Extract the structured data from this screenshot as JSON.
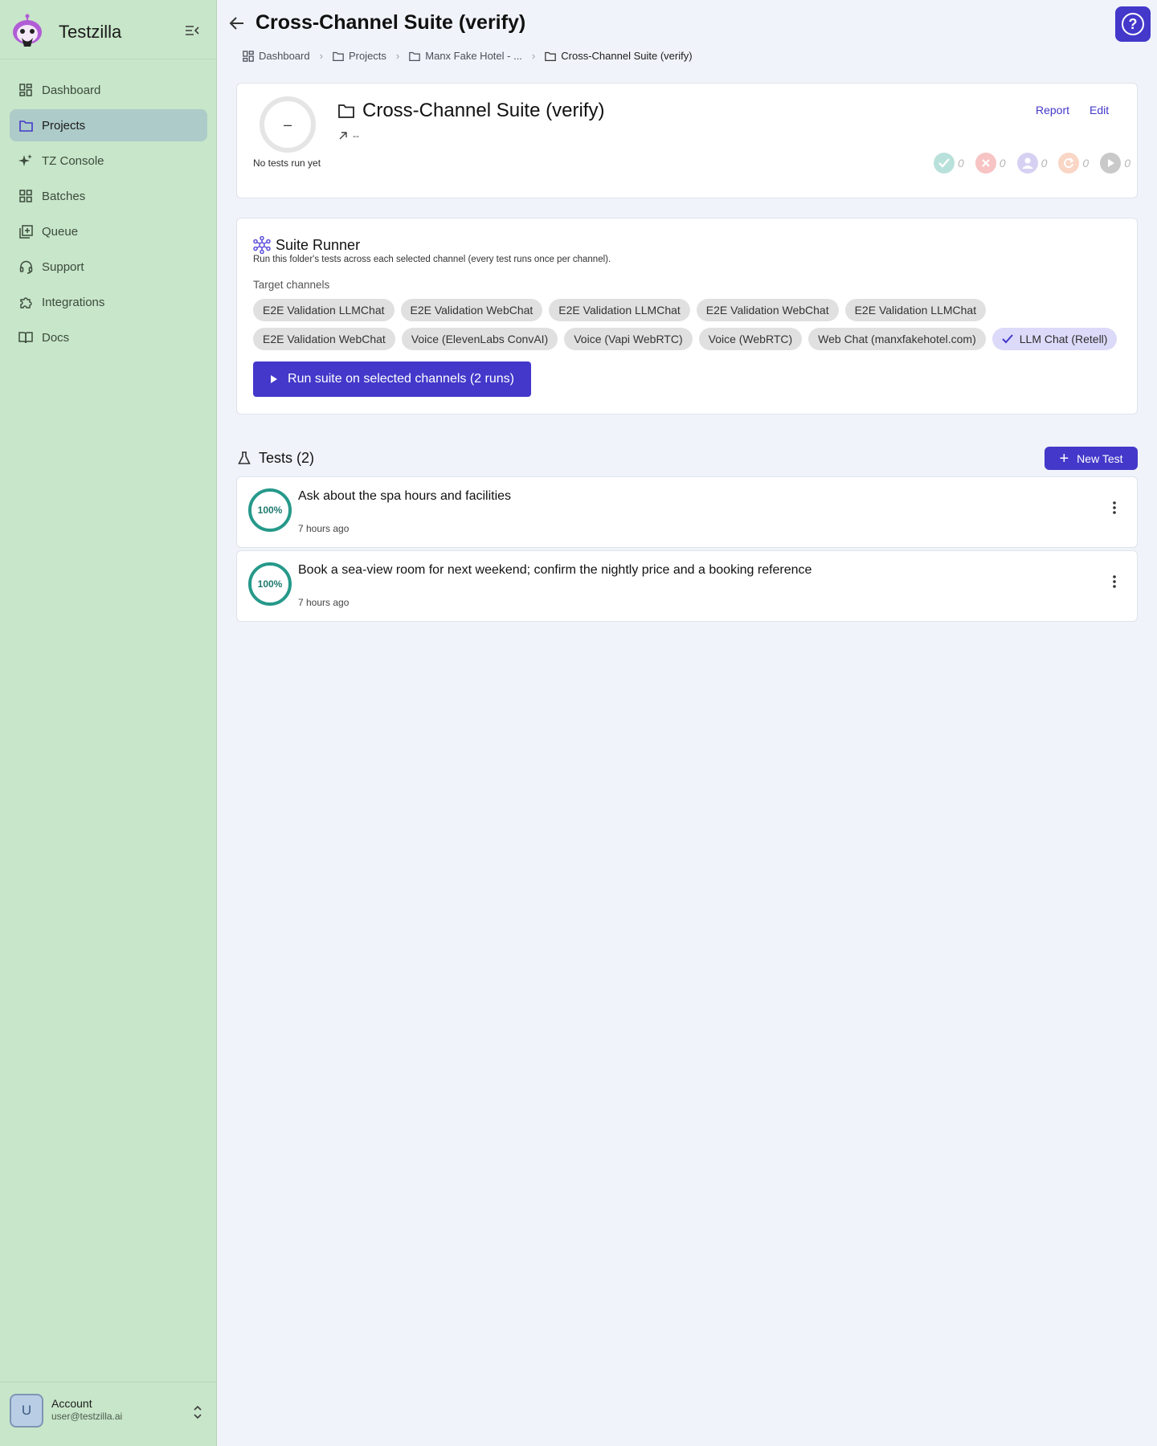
{
  "app": {
    "name": "Testzilla"
  },
  "sidebar": {
    "items": [
      {
        "label": "Dashboard",
        "icon": "dashboard-icon",
        "active": false
      },
      {
        "label": "Projects",
        "icon": "folder-icon",
        "active": true
      },
      {
        "label": "TZ Console",
        "icon": "sparkle-icon",
        "active": false
      },
      {
        "label": "Batches",
        "icon": "grid-icon",
        "active": false
      },
      {
        "label": "Queue",
        "icon": "queue-icon",
        "active": false
      },
      {
        "label": "Support",
        "icon": "headset-icon",
        "active": false
      },
      {
        "label": "Integrations",
        "icon": "puzzle-icon",
        "active": false
      },
      {
        "label": "Docs",
        "icon": "book-icon",
        "active": false
      }
    ]
  },
  "account": {
    "initial": "U",
    "name": "Account",
    "email": "user@testzilla.ai"
  },
  "header": {
    "title": "Cross-Channel Suite (verify)",
    "breadcrumb": [
      "Dashboard",
      "Projects",
      "Manx Fake Hotel - ...",
      "Cross-Channel Suite (verify)"
    ]
  },
  "summary": {
    "score": "–",
    "caption": "No tests run yet",
    "title": "Cross-Channel Suite (verify)",
    "trend": "--",
    "report_label": "Report",
    "edit_label": "Edit",
    "stats": {
      "passed": "0",
      "failed": "0",
      "review": "0",
      "retry": "0",
      "pending": "0"
    }
  },
  "runner": {
    "title": "Suite Runner",
    "description": "Run this folder's tests across each selected channel (every test runs once per channel).",
    "channels_label": "Target channels",
    "channels": [
      {
        "label": "E2E Validation LLMChat",
        "selected": false
      },
      {
        "label": "E2E Validation WebChat",
        "selected": false
      },
      {
        "label": "E2E Validation LLMChat",
        "selected": false
      },
      {
        "label": "E2E Validation WebChat",
        "selected": false
      },
      {
        "label": "E2E Validation LLMChat",
        "selected": false
      },
      {
        "label": "E2E Validation WebChat",
        "selected": false
      },
      {
        "label": "Voice (ElevenLabs ConvAI)",
        "selected": false
      },
      {
        "label": "Voice (Vapi WebRTC)",
        "selected": false
      },
      {
        "label": "Voice (WebRTC)",
        "selected": false
      },
      {
        "label": "Web Chat (manxfakehotel.com)",
        "selected": false
      },
      {
        "label": "LLM Chat (Retell)",
        "selected": true
      }
    ],
    "run_label": "Run suite on selected channels (2 runs)"
  },
  "tests": {
    "heading": "Tests (2)",
    "new_label": "New Test",
    "items": [
      {
        "score": "100%",
        "title": "Ask about the spa hours and facilities",
        "time": "7 hours ago"
      },
      {
        "score": "100%",
        "title": "Book a sea-view room for next weekend; confirm the nightly price and a booking reference",
        "time": "7 hours ago"
      }
    ]
  },
  "colors": {
    "accent": "#4338ca",
    "sidebar_bg": "#c8e6c9",
    "pass": "#26998a"
  }
}
